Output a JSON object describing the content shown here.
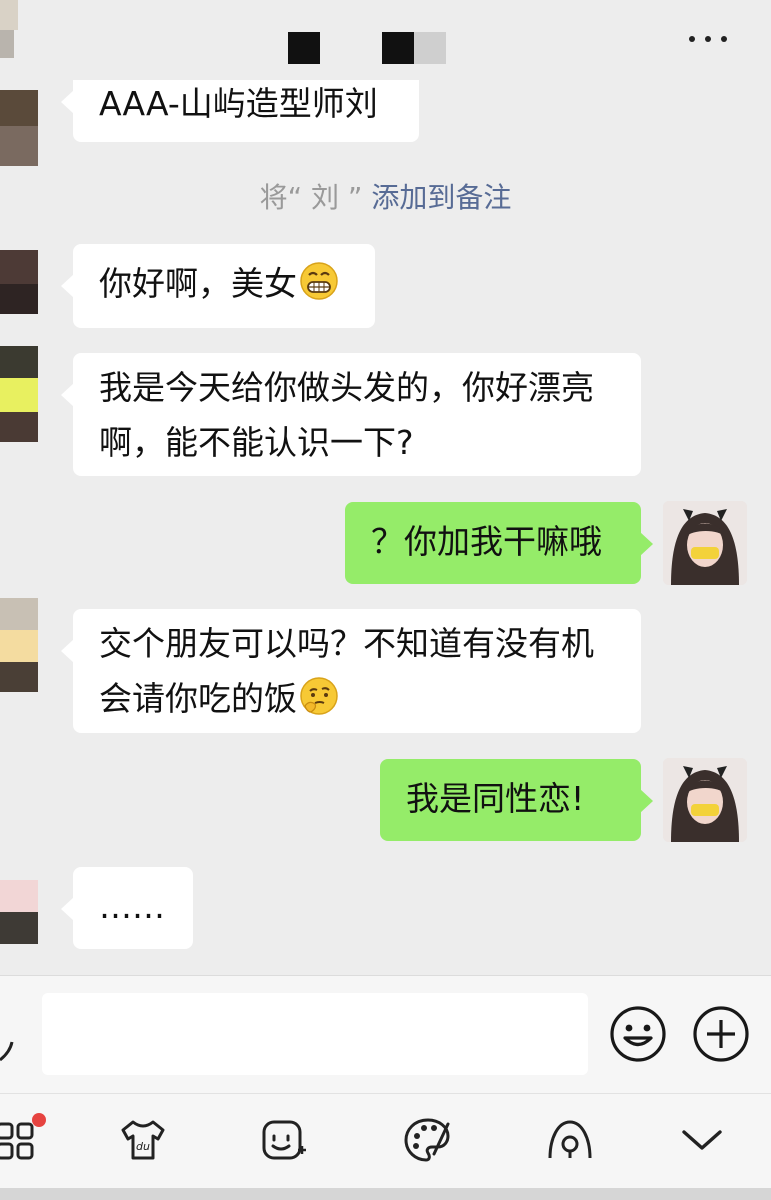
{
  "header": {
    "more_icon": "more-dots-icon"
  },
  "system_note": {
    "prefix": "将“ 刘 ”",
    "link": "添加到备注"
  },
  "messages": [
    {
      "side": "in",
      "lines": [
        "AAA-山屿造型师刘"
      ]
    },
    {
      "side": "in",
      "lines": [
        "你好啊，美女"
      ],
      "emoji": "grin-emoji-icon"
    },
    {
      "side": "in",
      "lines": [
        "我是今天给你做头发的，你好漂亮",
        "啊，能不能认识一下?"
      ]
    },
    {
      "side": "out",
      "lines": [
        "？你加我干嘛哦"
      ]
    },
    {
      "side": "in",
      "lines": [
        "交个朋友可以吗？不知道有没有机",
        "会请你吃的饭"
      ],
      "emoji": "thinking-emoji-icon"
    },
    {
      "side": "out",
      "lines": [
        "我是同性恋!"
      ]
    },
    {
      "side": "in",
      "lines": [
        "……"
      ]
    }
  ],
  "input_bar": {
    "emoji_button": "smiley-icon",
    "plus_button": "plus-circle-icon"
  },
  "toolbar": {
    "items": [
      "apps-grid-icon",
      "tshirt-du-icon",
      "sticker-face-icon",
      "palette-icon",
      "location-icon",
      "chevron-down-icon"
    ]
  },
  "colors": {
    "background": "#ededed",
    "incoming_bubble": "#ffffff",
    "outgoing_bubble": "#95ec69",
    "link": "#576b95",
    "badge": "#e64340"
  }
}
